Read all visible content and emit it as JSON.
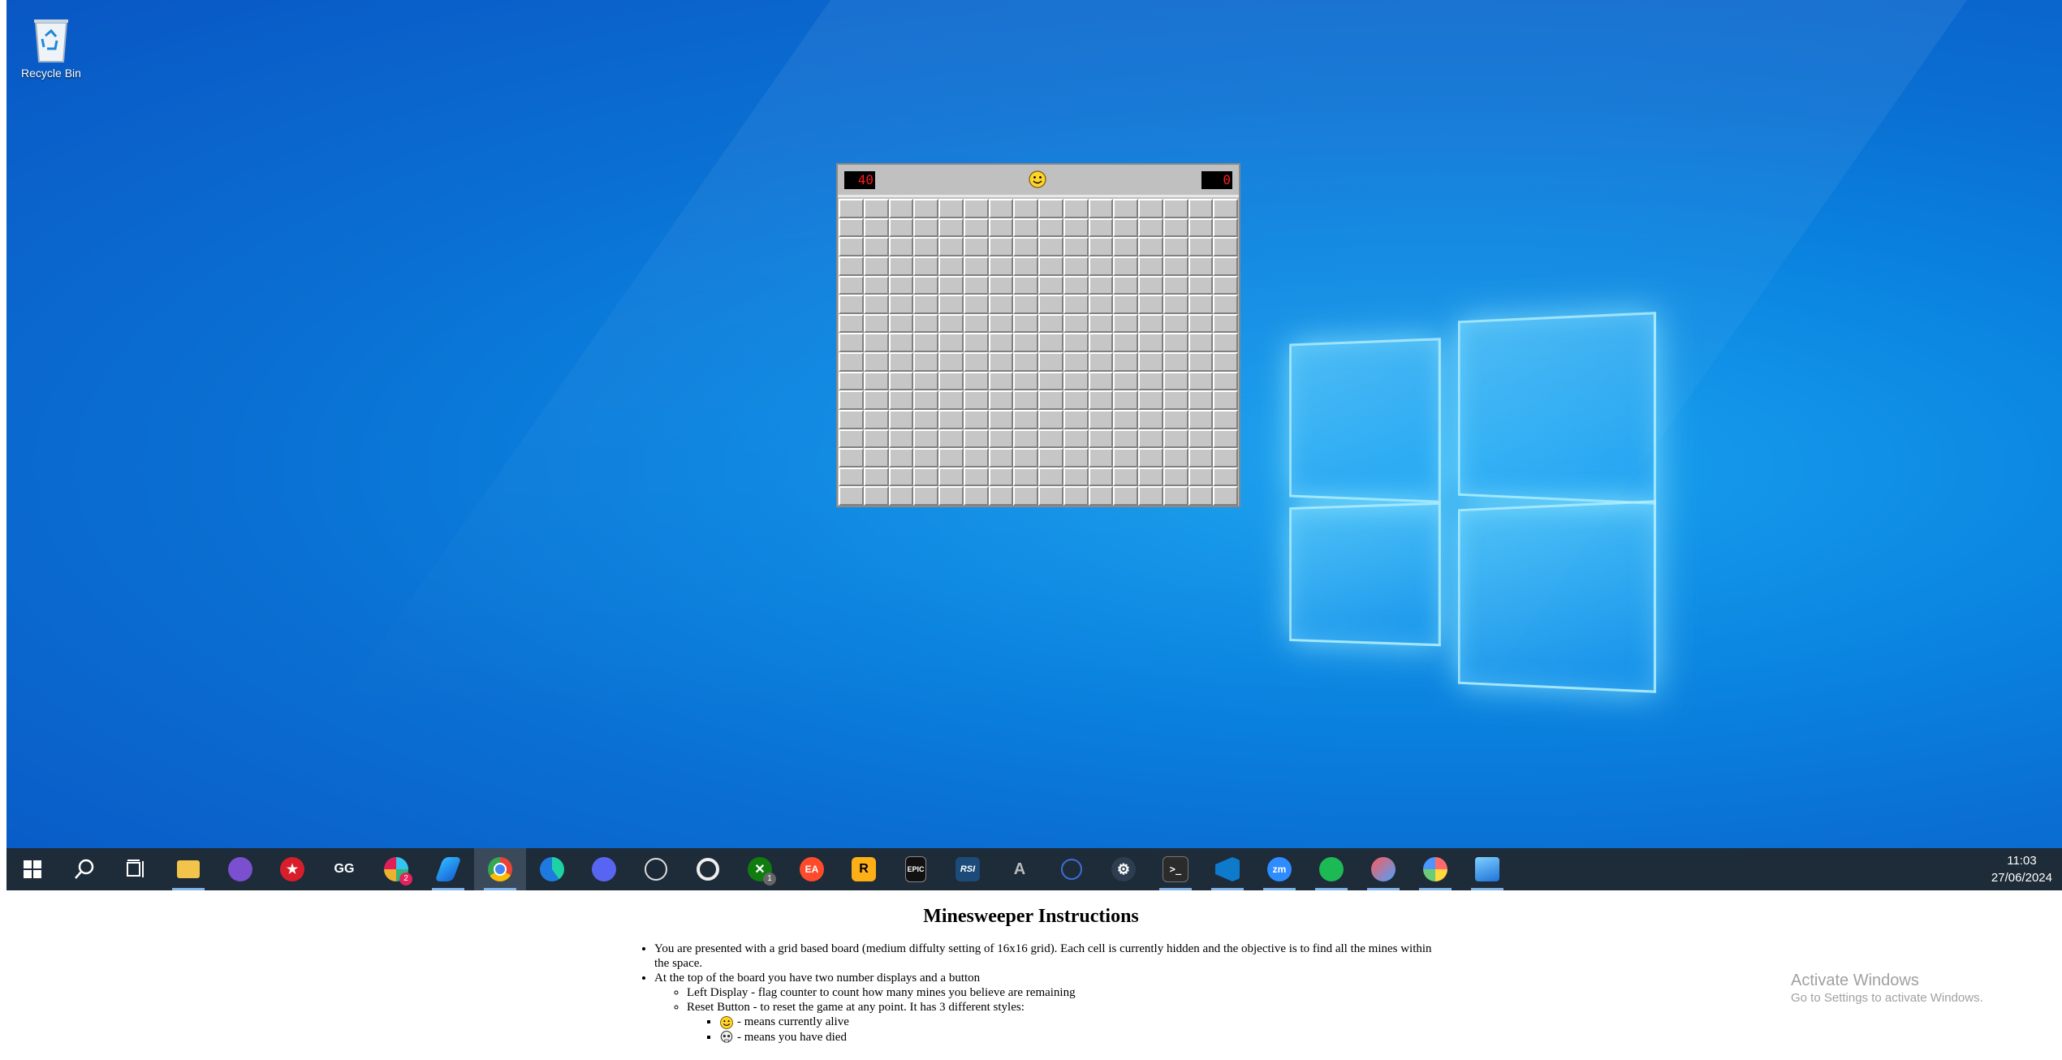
{
  "desktop": {
    "recycle_bin_label": "Recycle Bin"
  },
  "game": {
    "flag_counter": "40",
    "timer": "0",
    "reset_face": "smile",
    "rows": 16,
    "cols": 16
  },
  "taskbar": {
    "items": [
      {
        "name": "start-icon",
        "label": "Start"
      },
      {
        "name": "search-icon",
        "label": "Search"
      },
      {
        "name": "task-view-icon",
        "label": "Task View"
      },
      {
        "name": "file-explorer-icon",
        "label": "File Explorer"
      },
      {
        "name": "vpn-shield-icon",
        "label": "VPN"
      },
      {
        "name": "red-star-app-icon",
        "label": "App"
      },
      {
        "name": "gg-app-icon",
        "label": "GG"
      },
      {
        "name": "slack-icon",
        "label": "Slack",
        "badge": "2"
      },
      {
        "name": "notes-app-icon",
        "label": "App"
      },
      {
        "name": "chrome-icon",
        "label": "Chrome"
      },
      {
        "name": "edge-icon",
        "label": "Edge"
      },
      {
        "name": "discord-icon",
        "label": "Discord"
      },
      {
        "name": "steam-icon",
        "label": "Steam"
      },
      {
        "name": "ubisoft-icon",
        "label": "Ubisoft Connect"
      },
      {
        "name": "xbox-icon",
        "label": "Xbox",
        "badge": "1"
      },
      {
        "name": "ea-icon",
        "label": "EA"
      },
      {
        "name": "rockstar-icon",
        "label": "Rockstar"
      },
      {
        "name": "epic-games-icon",
        "label": "Epic Games"
      },
      {
        "name": "rsi-icon",
        "label": "RSI"
      },
      {
        "name": "launcher-a-icon",
        "label": "App"
      },
      {
        "name": "react-icon",
        "label": "App"
      },
      {
        "name": "settings-gear-icon",
        "label": "Settings"
      },
      {
        "name": "terminal-icon",
        "label": "Terminal"
      },
      {
        "name": "vscode-icon",
        "label": "VS Code"
      },
      {
        "name": "zoom-icon",
        "label": "Zoom"
      },
      {
        "name": "spotify-icon",
        "label": "Spotify"
      },
      {
        "name": "snipping-tool-icon",
        "label": "Snipping Tool"
      },
      {
        "name": "paint-icon",
        "label": "Paint"
      },
      {
        "name": "photos-icon",
        "label": "Photos"
      }
    ],
    "tb_text": {
      "gg": "GG",
      "ea": "EA",
      "rockstar": "R",
      "epic": "EPIC",
      "rsi": "RSI",
      "launcher_a": "A",
      "zoom": "zm"
    },
    "clock_time": "11:03",
    "clock_date": "27/06/2024"
  },
  "instructions": {
    "title": "Minesweeper Instructions",
    "item1": "You are presented with a grid based board (medium diffulty setting of 16x16 grid). Each cell is currently hidden and the objective is to find all the mines within the space.",
    "item2": "At the top of the board you have two number displays and a button",
    "sub1": "Left Display - flag counter to count how many mines you believe are remaining",
    "sub2": "Reset Button - to reset the game at any point. It has 3 different styles:",
    "style1": "- means currently alive",
    "style2": "- means you have died"
  },
  "watermark": {
    "line1": "Activate Windows",
    "line2": "Go to Settings to activate Windows."
  },
  "colors": {
    "taskbar": "#1e2b38",
    "desktop_blue": "#0a84e0",
    "lcd_red": "#ff1a1a"
  }
}
